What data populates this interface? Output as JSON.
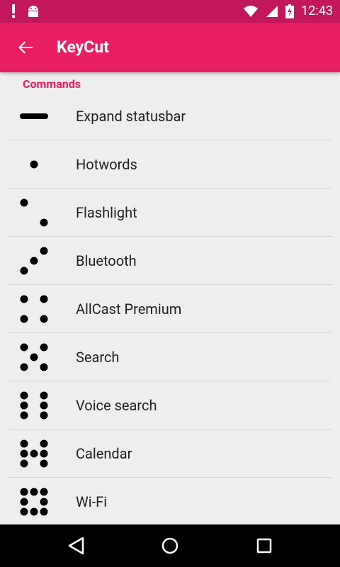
{
  "status_bar": {
    "time": "12:43",
    "left_icons": [
      "exclamation-icon",
      "android-icon"
    ],
    "right_icons": [
      "wifi-icon",
      "signal-icon",
      "battery-charging-icon"
    ]
  },
  "app_bar": {
    "title": "KeyCut",
    "back_icon": "arrow-back-icon",
    "color": "#e91e63",
    "status_color": "#c2185b"
  },
  "section": {
    "label": "Commands",
    "color": "#e91e63"
  },
  "commands": [
    {
      "label": "Expand statusbar",
      "pattern": "dash"
    },
    {
      "label": "Hotwords",
      "pattern": 1
    },
    {
      "label": "Flashlight",
      "pattern": 2
    },
    {
      "label": "Bluetooth",
      "pattern": 3
    },
    {
      "label": "AllCast Premium",
      "pattern": 4
    },
    {
      "label": "Search",
      "pattern": 5
    },
    {
      "label": "Voice search",
      "pattern": 6
    },
    {
      "label": "Calendar",
      "pattern": 7
    },
    {
      "label": "Wi-Fi",
      "pattern": 8
    }
  ],
  "nav_bar": {
    "back": "nav-back-icon",
    "home": "nav-home-icon",
    "recents": "nav-recents-icon"
  }
}
